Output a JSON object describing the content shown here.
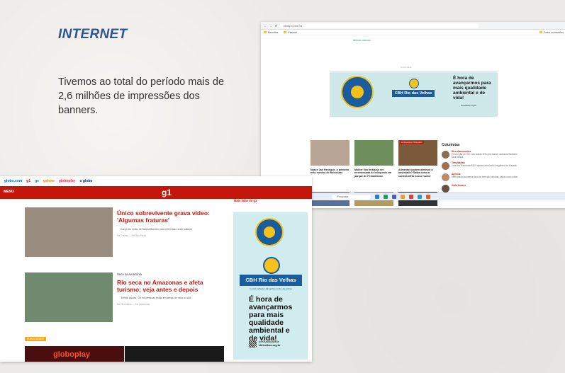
{
  "slide": {
    "title": "INTERNET",
    "body": "Tivemos ao total do período mais de 2,6 milhões de impressões dos banners."
  },
  "browser": {
    "url": "otempo.com.br",
    "bookmarks": [
      "Favoritos",
      "Pessoal",
      "Todos os favoritos"
    ],
    "top_text": "Últimas notícias",
    "ad_label": "Publicidade",
    "news": [
      {
        "caption": "Nasce Jair Henrique, o primeiro neto menino de Bolsonaro"
      },
      {
        "caption": "Mulher fica ferida ao ser arremessada de brinquedo em parque de Pernambuco"
      },
      {
        "caption": "Alimentos podem diminuir a ansiedade? Saiba como a comida afeta nosso humor",
        "badge": "CONHEÇA PINGADO"
      }
    ],
    "colunistas": {
      "title": "Colunistas",
      "items": [
        {
          "name": "Rico Vasconcelos",
          "text": "Prevenção do HIV e de outras ISTs precisa ser acessível também para idosos"
        },
        {
          "name": "Tony Marlon",
          "text": "Lula dos Racionais MC's ajuda na inclusão de gênero no Paraná"
        },
        {
          "name": "Agência",
          "text": "Menopausa aumenta risco de infecção urinária; saiba como evitar"
        },
        {
          "name": "Gioia Kramer",
          "text": ""
        }
      ]
    },
    "taskbar_search": "Pesquisar"
  },
  "g1": {
    "topnav": [
      "globo.com",
      "g1",
      "ge",
      "gshow",
      "globoplay",
      "o globo"
    ],
    "menu": "MENU",
    "logo": "g1",
    "more": "Mais lidas do g1",
    "story1": {
      "headline": "Único sobrevivente grava vídeo: 'Algumas fraturas'",
      "bullet": "Corpo do irmão de Sálma Bomfim será enterrado neste sábado",
      "meta": "Há 2 horas — Em São Paulo"
    },
    "story2": {
      "kicker": "Seca na Amazônia",
      "headline": "Rio seca no Amazonas e afeta turismo; veja antes e depois",
      "bullet": "'Terras caídas': 29 mil pessoas estão em áreas de risco no AM",
      "meta": "Há 21 minutos — Em Amazonas"
    },
    "pub": "PUBLICIDADE",
    "globoplay": "globoplay"
  },
  "ad": {
    "seal": "#VELHASFAÇOPARTE SANEAMENTO JÁ",
    "brand": "CBH Rio das Velhas",
    "subtitle": "Comitê da Bacia Hidrográfica do Rio das Velhas",
    "slogan": "É hora de avançarmos para mais qualidade ambiental e de vida!",
    "hashtag": "#velhasfaçoparte",
    "site": "cbhvelhas.org.br"
  },
  "colors": {
    "g1_red": "#c4170c",
    "slide_blue": "#2f5597",
    "ad_blue": "#1a5c9c",
    "ad_yellow": "#f3c31c",
    "ad_bg": "#d0ecee"
  }
}
